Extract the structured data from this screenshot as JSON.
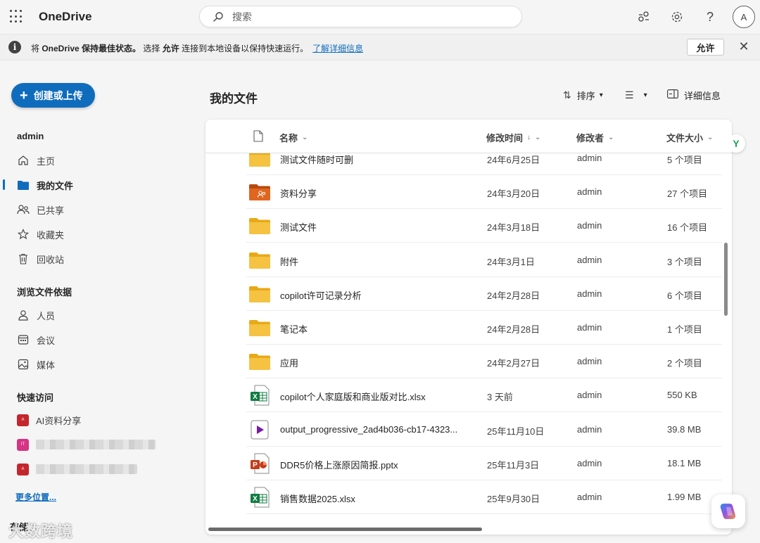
{
  "header": {
    "app_name": "OneDrive",
    "search_placeholder": "搜索",
    "avatar_initial": "A",
    "icons": [
      "waffle-icon",
      "search-icon",
      "share-feed-icon",
      "gear-icon",
      "help-icon"
    ]
  },
  "infobar": {
    "text_1": "将 ",
    "text_bold_1": "OneDrive 保持最佳状态。",
    "text_2": " 选择 ",
    "text_bold_2": "允许",
    "text_3": " 连接到本地设备以保持快速运行。",
    "link": "了解详细信息",
    "allow_label": "允许"
  },
  "sidebar": {
    "create_label": "创建或上传",
    "user": "admin",
    "nav": [
      {
        "label": "主页",
        "icon": "home-icon"
      },
      {
        "label": "我的文件",
        "icon": "folder-icon",
        "active": true
      },
      {
        "label": "已共享",
        "icon": "people-icon"
      },
      {
        "label": "收藏夹",
        "icon": "star-icon"
      },
      {
        "label": "回收站",
        "icon": "trash-icon"
      }
    ],
    "browse_title": "浏览文件依据",
    "browse": [
      {
        "label": "人员",
        "icon": "person-icon"
      },
      {
        "label": "会议",
        "icon": "calendar-icon"
      },
      {
        "label": "媒体",
        "icon": "image-icon"
      }
    ],
    "quick_title": "快速访问",
    "quick": [
      {
        "label": "AI资料分享",
        "badge_color": "#c4262e"
      }
    ],
    "more_link": "更多位置...",
    "storage_label": "存储"
  },
  "main": {
    "title": "我的文件",
    "sort_label": "排序",
    "details_label": "详细信息",
    "columns": {
      "name": "名称",
      "modified": "修改时间",
      "modified_by": "修改者",
      "size": "文件大小"
    },
    "files": [
      {
        "type": "folder",
        "name": "测试文件随时可删",
        "modified": "24年6月25日",
        "by": "admin",
        "size": "5 个项目"
      },
      {
        "type": "shared-folder",
        "name": "资料分享",
        "modified": "24年3月20日",
        "by": "admin",
        "size": "27 个项目"
      },
      {
        "type": "folder",
        "name": "测试文件",
        "modified": "24年3月18日",
        "by": "admin",
        "size": "16 个项目"
      },
      {
        "type": "folder",
        "name": "附件",
        "modified": "24年3月1日",
        "by": "admin",
        "size": "3 个项目"
      },
      {
        "type": "folder",
        "name": "copilot许可记录分析",
        "modified": "24年2月28日",
        "by": "admin",
        "size": "6 个项目"
      },
      {
        "type": "folder",
        "name": "笔记本",
        "modified": "24年2月28日",
        "by": "admin",
        "size": "1 个项目"
      },
      {
        "type": "folder",
        "name": "应用",
        "modified": "24年2月27日",
        "by": "admin",
        "size": "2 个项目"
      },
      {
        "type": "xlsx",
        "name": "copilot个人家庭版和商业版对比.xlsx",
        "modified": "3 天前",
        "by": "admin",
        "size": "550 KB"
      },
      {
        "type": "video",
        "name": "output_progressive_2ad4b036-cb17-4323...",
        "modified": "25年11月10日",
        "by": "admin",
        "size": "39.8 MB"
      },
      {
        "type": "pptx",
        "name": "DDR5价格上涨原因简报.pptx",
        "modified": "25年11月3日",
        "by": "admin",
        "size": "18.1 MB"
      },
      {
        "type": "xlsx",
        "name": "销售数据2025.xlsx",
        "modified": "25年9月30日",
        "by": "admin",
        "size": "1.99 MB"
      }
    ]
  },
  "watermark": "大数跨境",
  "colors": {
    "accent": "#0f6cbd",
    "folder": "#f5c242",
    "shared_folder": "#e0661f",
    "excel": "#107c41",
    "powerpoint": "#c43e1c",
    "video": "#7719aa"
  }
}
